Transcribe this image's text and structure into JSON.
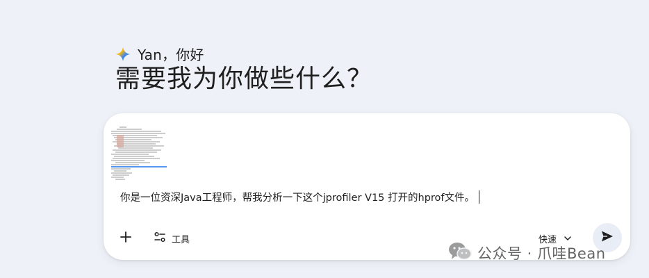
{
  "greeting": {
    "text": "Yan，你好"
  },
  "headline": "需要我为你做些什么？",
  "composer": {
    "prompt_text": "你是一位资深Java工程师，帮我分析一下这个jprofiler V15 打开的hprof文件。",
    "tools_label": "工具",
    "mode_label": "快速"
  },
  "watermark": {
    "text": "公众号 · 爪哇Bean"
  },
  "colors": {
    "background": "#eef1f7",
    "card": "#ffffff",
    "send_button_bg": "#e9edf5",
    "sparkle_blue": "#4285f4",
    "sparkle_red": "#ea4335",
    "sparkle_yellow": "#fbbc04",
    "sparkle_green": "#34a853"
  },
  "icons": {
    "greeting": "gemini-sparkle-icon",
    "plus": "plus-icon",
    "tools": "tools-sliders-icon",
    "mode_dropdown": "chevron-down-icon",
    "send": "send-arrow-icon",
    "watermark": "wechat-icon"
  }
}
